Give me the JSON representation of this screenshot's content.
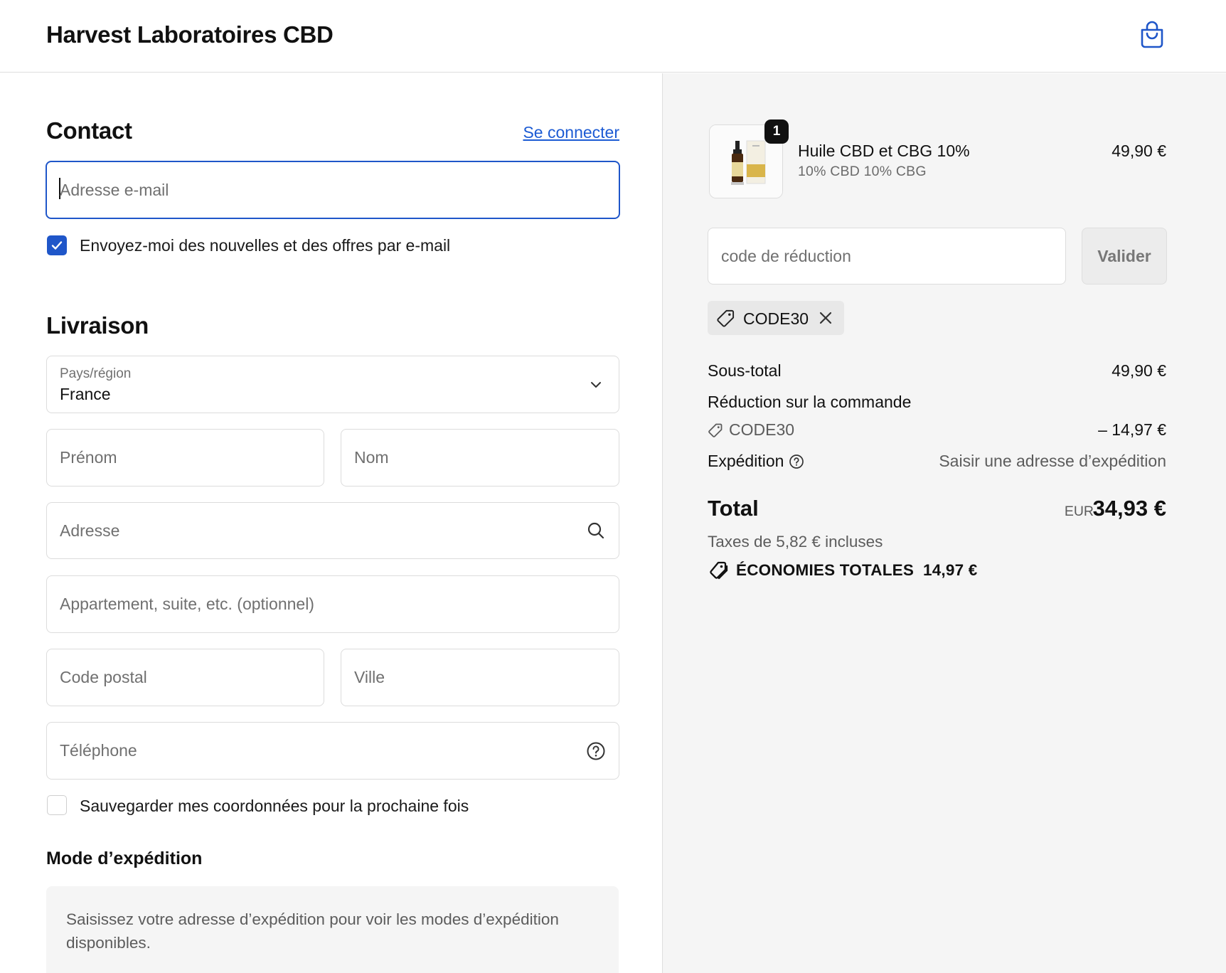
{
  "header": {
    "brand": "Harvest Laboratoires CBD",
    "cart_icon": "shopping-bag-icon"
  },
  "contact": {
    "title": "Contact",
    "login_link": "Se connecter",
    "email_placeholder": "Adresse e-mail",
    "newsletter_label": "Envoyez-moi des nouvelles et des offres par e-mail",
    "newsletter_checked": true
  },
  "shipping": {
    "title": "Livraison",
    "country_label": "Pays/région",
    "country_value": "France",
    "first_name_placeholder": "Prénom",
    "last_name_placeholder": "Nom",
    "address_placeholder": "Adresse",
    "apartment_placeholder": "Appartement, suite, etc. (optionnel)",
    "postal_code_placeholder": "Code postal",
    "city_placeholder": "Ville",
    "phone_placeholder": "Téléphone",
    "save_info_label": "Sauvegarder mes coordonnées pour la prochaine fois",
    "save_info_checked": false
  },
  "shipping_method": {
    "title": "Mode d’expédition",
    "notice": "Saisissez votre adresse d’expédition pour voir les modes d’expédition disponibles."
  },
  "summary": {
    "product": {
      "quantity": "1",
      "name": "Huile CBD et CBG 10%",
      "variant": "10% CBD 10% CBG",
      "price": "49,90 €"
    },
    "discount_placeholder": "code de réduction",
    "apply_button": "Valider",
    "applied_code": "CODE30",
    "subtotal_label": "Sous-total",
    "subtotal_value": "49,90 €",
    "order_discount_label": "Réduction sur la commande",
    "discount_code": "CODE30",
    "discount_value": "– 14,97 €",
    "shipping_label": "Expédition",
    "shipping_value": "Saisir une adresse d’expédition",
    "total_label": "Total",
    "currency": "EUR",
    "total_value": "34,93 €",
    "taxes": "Taxes de 5,82 € incluses",
    "savings": "ÉCONOMIES TOTALES  14,97 €"
  },
  "colors": {
    "accent": "#1f56c9",
    "link": "#1c5bd4",
    "panel_bg": "#f5f5f5"
  }
}
